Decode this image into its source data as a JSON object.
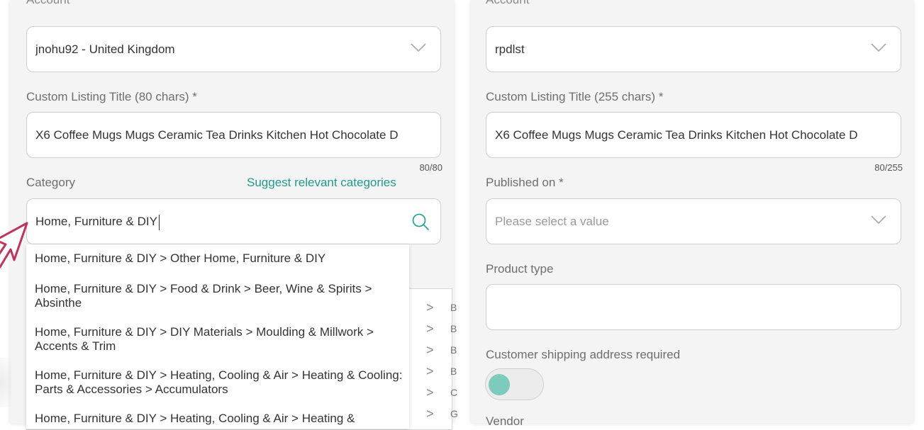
{
  "left": {
    "account_label": "Account",
    "account_value": "jnohu92 - United Kingdom",
    "title_label": "Custom Listing Title (80 chars) *",
    "title_value": "X6 Coffee Mugs Mugs Ceramic Tea Drinks Kitchen Hot Chocolate D",
    "title_counter": "80/80",
    "category_label": "Category",
    "suggest_link": "Suggest relevant categories",
    "category_value": "Home, Furniture & DIY",
    "dropdown_items": [
      "Home, Furniture & DIY > Other Home, Furniture & DIY",
      "Home, Furniture & DIY > Food & Drink > Beer, Wine & Spirits > Absinthe",
      "Home, Furniture & DIY > DIY Materials > Moulding & Millwork > Accents & Trim",
      "Home, Furniture & DIY > Heating, Cooling & Air > Heating & Cooling: Parts & Accessories > Accumulators",
      "Home, Furniture & DIY > Heating, Cooling & Air > Heating &"
    ],
    "tree_letters": [
      "B",
      "B",
      "B",
      "B",
      "C",
      "G"
    ]
  },
  "right": {
    "account_label": "Account",
    "account_value": "rpdlst",
    "title_label": "Custom Listing Title (255 chars) *",
    "title_value": "X6 Coffee Mugs Mugs Ceramic Tea Drinks Kitchen Hot Chocolate D",
    "title_counter": "80/255",
    "published_label": "Published on *",
    "published_placeholder": "Please select a value",
    "product_type_label": "Product type",
    "product_type_value": "",
    "shipping_label": "Customer shipping address required",
    "shipping_toggle_on": false,
    "vendor_label": "Vendor"
  },
  "colors": {
    "accent": "#1f9b8b",
    "toggle_knob": "#7ccbbd",
    "cursor": "#c0345c"
  }
}
